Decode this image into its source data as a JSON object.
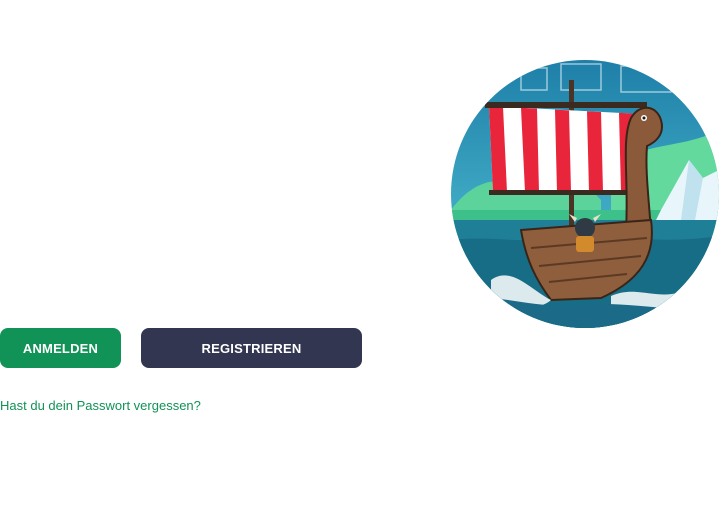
{
  "actions": {
    "login_label": "ANMELDEN",
    "register_label": "REGISTRIEREN",
    "forgot_password_label": "Hast du dein Passwort vergessen?"
  },
  "colors": {
    "login_button": "#119256",
    "register_button": "#323650",
    "link": "#119256"
  },
  "illustration": {
    "icon": "viking-ship-illustration"
  }
}
